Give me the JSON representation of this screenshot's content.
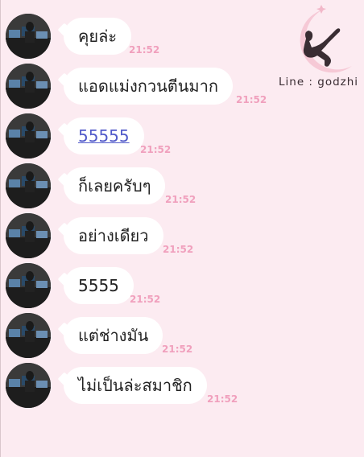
{
  "brand": {
    "label": "Line : godzhi"
  },
  "messages": [
    {
      "text": "คุยล่ะ",
      "time": "21:52",
      "link": false
    },
    {
      "text": "แอดแม่งกวนตีนมาก",
      "time": "21:52",
      "link": false
    },
    {
      "text": "55555",
      "time": "21:52",
      "link": true
    },
    {
      "text": "ก็เลยครับๆ",
      "time": "21:52",
      "link": false
    },
    {
      "text": "อย่างเดียว",
      "time": "21:52",
      "link": false
    },
    {
      "text": "5555",
      "time": "21:52",
      "link": false
    },
    {
      "text": "แต่ช่างมัน",
      "time": "21:52",
      "link": false
    },
    {
      "text": "ไม่เป็นล่ะสมาชิก",
      "time": "21:52",
      "link": false
    }
  ],
  "colors": {
    "background": "#fcebf1",
    "timestamp": "#f0a0bd",
    "link": "#5059c9",
    "bubble": "#ffffff"
  }
}
